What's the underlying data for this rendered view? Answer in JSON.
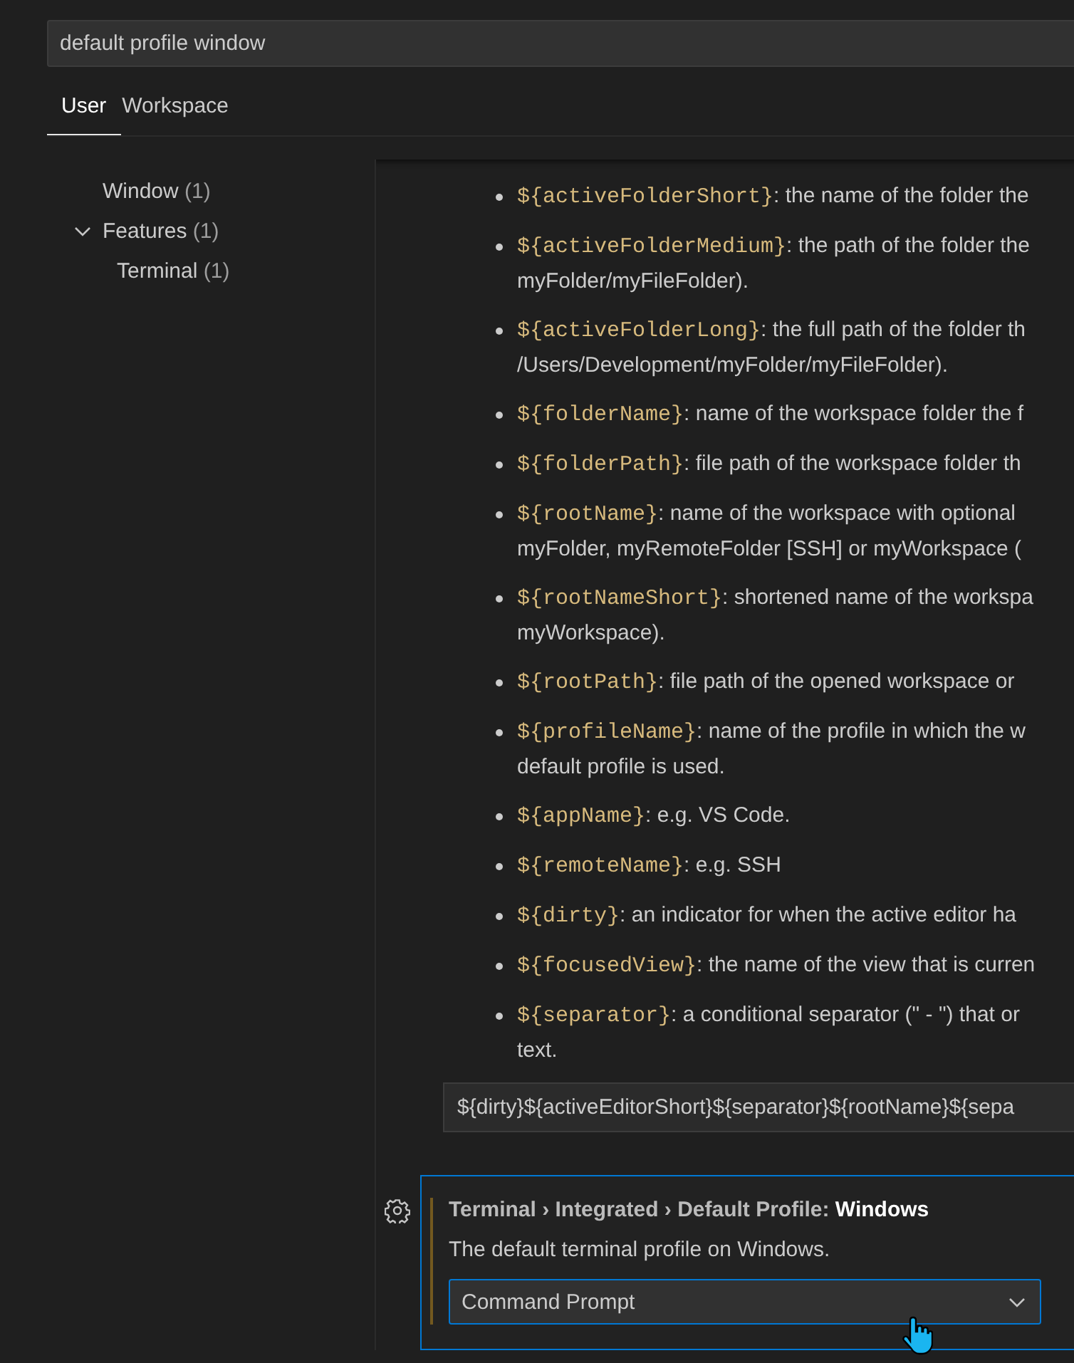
{
  "search": {
    "value": "default profile window"
  },
  "tabs": [
    {
      "label": "User",
      "selected": true
    },
    {
      "label": "Workspace",
      "selected": false
    }
  ],
  "tree": [
    {
      "label": "Window",
      "count": "(1)"
    },
    {
      "label": "Features",
      "count": "(1)",
      "expanded": true,
      "children": [
        {
          "label": "Terminal",
          "count": "(1)"
        }
      ]
    }
  ],
  "variables": [
    {
      "variable": "${activeFolderShort}",
      "lines": [
        ": the name of the folder the"
      ]
    },
    {
      "variable": "${activeFolderMedium}",
      "lines": [
        ": the path of the folder the",
        "myFolder/myFileFolder)."
      ]
    },
    {
      "variable": "${activeFolderLong}",
      "lines": [
        ": the full path of the folder th",
        "/Users/Development/myFolder/myFileFolder)."
      ]
    },
    {
      "variable": "${folderName}",
      "lines": [
        ": name of the workspace folder the f"
      ]
    },
    {
      "variable": "${folderPath}",
      "lines": [
        ": file path of the workspace folder th"
      ]
    },
    {
      "variable": "${rootName}",
      "lines": [
        ": name of the workspace with optional",
        "myFolder, myRemoteFolder [SSH] or myWorkspace ("
      ]
    },
    {
      "variable": "${rootNameShort}",
      "lines": [
        ": shortened name of the workspa",
        "myWorkspace)."
      ]
    },
    {
      "variable": "${rootPath}",
      "lines": [
        ": file path of the opened workspace or"
      ]
    },
    {
      "variable": "${profileName}",
      "lines": [
        ": name of the profile in which the w",
        "default profile is used."
      ]
    },
    {
      "variable": "${appName}",
      "lines": [
        ": e.g. VS Code."
      ]
    },
    {
      "variable": "${remoteName}",
      "lines": [
        ": e.g. SSH"
      ]
    },
    {
      "variable": "${dirty}",
      "lines": [
        ": an indicator for when the active editor ha"
      ]
    },
    {
      "variable": "${focusedView}",
      "lines": [
        ": the name of the view that is curren"
      ]
    },
    {
      "variable": "${separator}",
      "lines": [
        ": a conditional separator (\" - \") that or",
        "text."
      ]
    }
  ],
  "title_value": "${dirty}${activeEditorShort}${separator}${rootName}${sepa",
  "setting": {
    "category": "Terminal › Integrated › Default Profile: ",
    "name": "Windows",
    "modified": true,
    "focused": true,
    "description": "The default terminal profile on Windows.",
    "value": "Command Prompt"
  }
}
